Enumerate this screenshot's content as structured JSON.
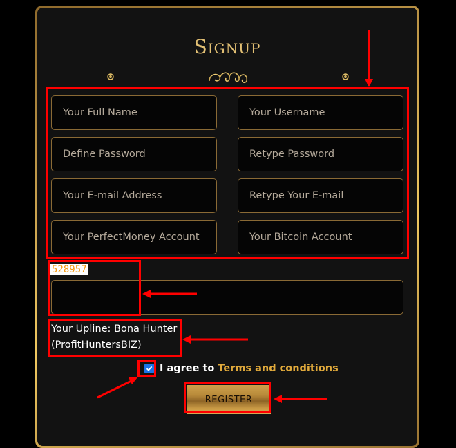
{
  "form": {
    "title": "Signup",
    "fields": [
      {
        "name": "full-name",
        "placeholder": "Your Full Name",
        "value": ""
      },
      {
        "name": "username",
        "placeholder": "Your Username",
        "value": ""
      },
      {
        "name": "define-password",
        "placeholder": "Define Password",
        "value": ""
      },
      {
        "name": "retype-password",
        "placeholder": "Retype Password",
        "value": ""
      },
      {
        "name": "email",
        "placeholder": "Your E-mail Address",
        "value": ""
      },
      {
        "name": "retype-email",
        "placeholder": "Retype Your E-mail",
        "value": ""
      },
      {
        "name": "perfectmoney-account",
        "placeholder": "Your PerfectMoney Account",
        "value": ""
      },
      {
        "name": "bitcoin-account",
        "placeholder": "Your Bitcoin Account",
        "value": ""
      }
    ],
    "captcha_code": "528957",
    "captcha_value": "",
    "upline_line1": "Your Upline: Bona Hunter",
    "upline_line2": "(ProfitHuntersBIZ)",
    "agree_text": "I agree to",
    "terms_link": "Terms and conditions",
    "agree_checked": true,
    "register_label": "REGISTER"
  },
  "colors": {
    "gold_accent": "#e2c074",
    "terms_link": "#e0a93b",
    "captcha_text": "#f59a12",
    "annotation_red": "#ff0000",
    "checkbox_blue": "#1a73e8"
  }
}
